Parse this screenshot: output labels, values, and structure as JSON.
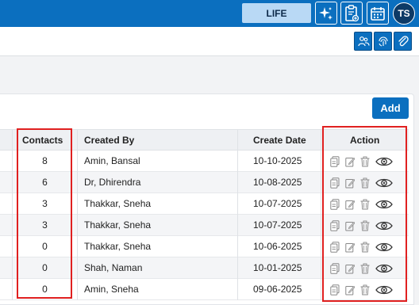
{
  "topbar": {
    "life_label": "LIFE",
    "avatar_initials": "TS",
    "icons": [
      "sparkle-icon",
      "clipboard-add-icon",
      "calendar-icon"
    ]
  },
  "toolbar2": {
    "icons": [
      "users-icon",
      "fingerprint-icon",
      "paperclip-icon"
    ]
  },
  "card": {
    "add_label": "Add"
  },
  "table": {
    "headers": {
      "contacts": "Contacts",
      "created_by": "Created By",
      "create_date": "Create Date",
      "action": "Action"
    },
    "rows": [
      {
        "contacts": "8",
        "created_by": "Amin, Bansal",
        "create_date": "10-10-2025"
      },
      {
        "contacts": "6",
        "created_by": "Dr, Dhirendra",
        "create_date": "10-08-2025"
      },
      {
        "contacts": "3",
        "created_by": "Thakkar, Sneha",
        "create_date": "10-07-2025"
      },
      {
        "contacts": "3",
        "created_by": "Thakkar, Sneha",
        "create_date": "10-07-2025"
      },
      {
        "contacts": "0",
        "created_by": "Thakkar, Sneha",
        "create_date": "10-06-2025"
      },
      {
        "contacts": "0",
        "created_by": "Shah, Naman",
        "create_date": "10-01-2025"
      },
      {
        "contacts": "0",
        "created_by": "Amin, Sneha",
        "create_date": "09-06-2025"
      }
    ]
  },
  "colors": {
    "brand": "#0b6fbf",
    "highlight": "#e02020"
  }
}
